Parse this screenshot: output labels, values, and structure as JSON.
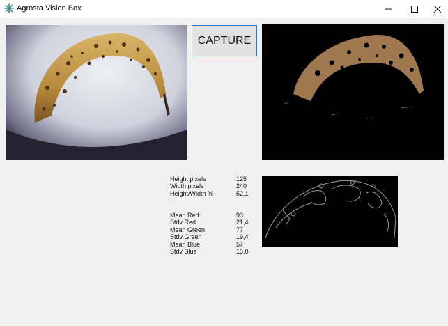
{
  "window": {
    "title": "Agrosta Vision Box",
    "app_icon": "star-burst-icon",
    "controls": [
      "minimize-icon",
      "maximize-icon",
      "close-icon"
    ]
  },
  "capture_button": {
    "label": "CAPTURE"
  },
  "geometry_stats": [
    {
      "label": "Height pixels",
      "value": "125"
    },
    {
      "label": "Width pixels",
      "value": "240"
    },
    {
      "label": "Height/Width %",
      "value": "52,1"
    }
  ],
  "color_stats": [
    {
      "label": "Mean Red",
      "value": "93"
    },
    {
      "label": "Stdv Red",
      "value": "21,4"
    },
    {
      "label": "Mean Green",
      "value": "77"
    },
    {
      "label": "Stdv Green",
      "value": "19,4"
    },
    {
      "label": "Mean Blue",
      "value": "57"
    },
    {
      "label": "Stdv Blue",
      "value": "15,0"
    }
  ],
  "colors": {
    "accent": "#2f79d4",
    "window_bg": "#f0f0f0",
    "banana": "#c9a04a",
    "spots": "#4a2e16"
  }
}
